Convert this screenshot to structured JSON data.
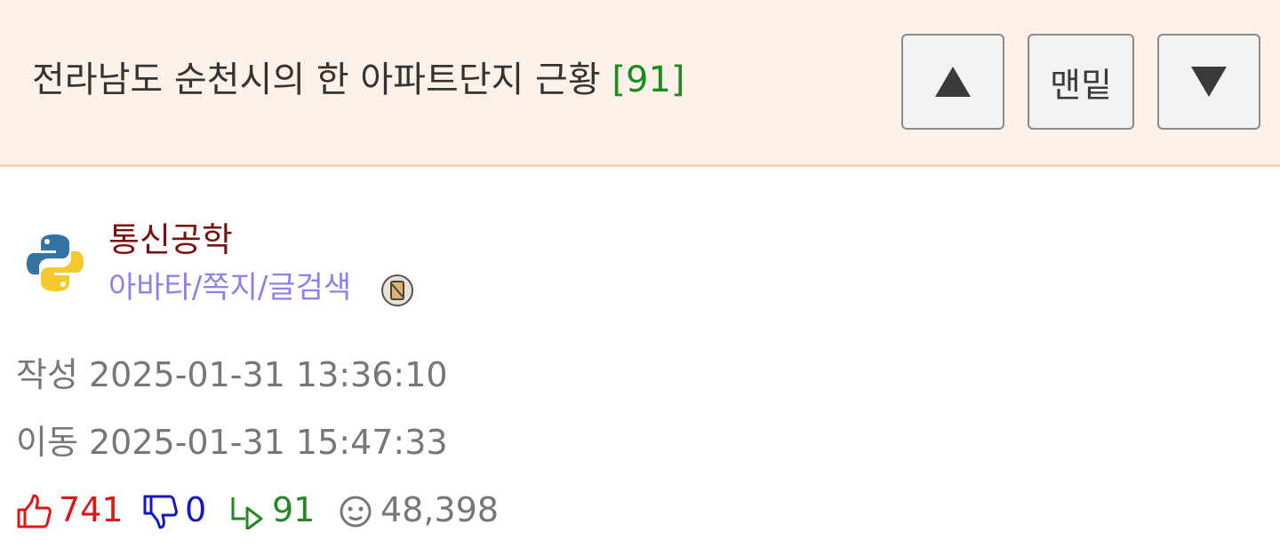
{
  "post": {
    "title": "전라남도 순천시의 한 아파트단지 근황",
    "comment_count": "[91]"
  },
  "nav": {
    "up_label": "▲",
    "bottom_label": "맨밑",
    "down_label": "▼"
  },
  "author": {
    "name": "통신공학",
    "links": "아바타/쪽지/글검색",
    "avatar_icon": "python-logo-icon",
    "badge_icon": "member-badge-icon"
  },
  "meta": {
    "written": "작성 2025-01-31 13:36:10",
    "moved": "이동 2025-01-31 15:47:33"
  },
  "stats": {
    "likes": "741",
    "dislikes": "0",
    "replies": "91",
    "views": "48,398"
  },
  "colors": {
    "header_bg": "#fcf1e8",
    "author_name": "#7a1010",
    "author_links": "#8a82ee",
    "comment_count": "#1f8a1f",
    "likes": "#e01616",
    "dislikes": "#1515c8",
    "replies": "#1f8a1f",
    "meta_text": "#777777"
  }
}
